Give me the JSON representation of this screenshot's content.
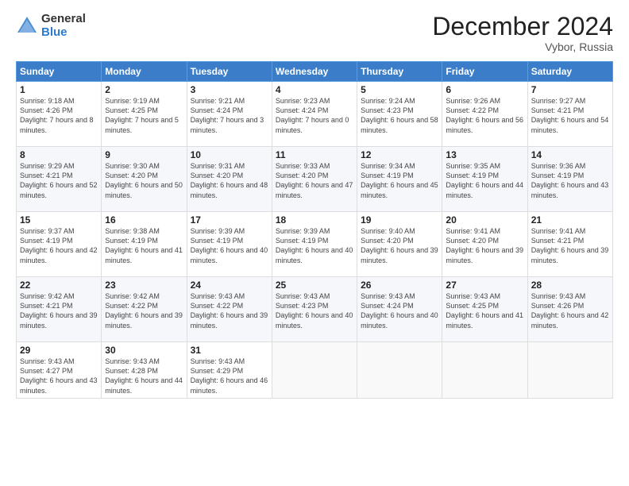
{
  "header": {
    "logo_general": "General",
    "logo_blue": "Blue",
    "month_title": "December 2024",
    "location": "Vybor, Russia"
  },
  "weekdays": [
    "Sunday",
    "Monday",
    "Tuesday",
    "Wednesday",
    "Thursday",
    "Friday",
    "Saturday"
  ],
  "weeks": [
    [
      {
        "day": "1",
        "sunrise": "9:18 AM",
        "sunset": "4:26 PM",
        "daylight": "7 hours and 8 minutes."
      },
      {
        "day": "2",
        "sunrise": "9:19 AM",
        "sunset": "4:25 PM",
        "daylight": "7 hours and 5 minutes."
      },
      {
        "day": "3",
        "sunrise": "9:21 AM",
        "sunset": "4:24 PM",
        "daylight": "7 hours and 3 minutes."
      },
      {
        "day": "4",
        "sunrise": "9:23 AM",
        "sunset": "4:24 PM",
        "daylight": "7 hours and 0 minutes."
      },
      {
        "day": "5",
        "sunrise": "9:24 AM",
        "sunset": "4:23 PM",
        "daylight": "6 hours and 58 minutes."
      },
      {
        "day": "6",
        "sunrise": "9:26 AM",
        "sunset": "4:22 PM",
        "daylight": "6 hours and 56 minutes."
      },
      {
        "day": "7",
        "sunrise": "9:27 AM",
        "sunset": "4:21 PM",
        "daylight": "6 hours and 54 minutes."
      }
    ],
    [
      {
        "day": "8",
        "sunrise": "9:29 AM",
        "sunset": "4:21 PM",
        "daylight": "6 hours and 52 minutes."
      },
      {
        "day": "9",
        "sunrise": "9:30 AM",
        "sunset": "4:20 PM",
        "daylight": "6 hours and 50 minutes."
      },
      {
        "day": "10",
        "sunrise": "9:31 AM",
        "sunset": "4:20 PM",
        "daylight": "6 hours and 48 minutes."
      },
      {
        "day": "11",
        "sunrise": "9:33 AM",
        "sunset": "4:20 PM",
        "daylight": "6 hours and 47 minutes."
      },
      {
        "day": "12",
        "sunrise": "9:34 AM",
        "sunset": "4:19 PM",
        "daylight": "6 hours and 45 minutes."
      },
      {
        "day": "13",
        "sunrise": "9:35 AM",
        "sunset": "4:19 PM",
        "daylight": "6 hours and 44 minutes."
      },
      {
        "day": "14",
        "sunrise": "9:36 AM",
        "sunset": "4:19 PM",
        "daylight": "6 hours and 43 minutes."
      }
    ],
    [
      {
        "day": "15",
        "sunrise": "9:37 AM",
        "sunset": "4:19 PM",
        "daylight": "6 hours and 42 minutes."
      },
      {
        "day": "16",
        "sunrise": "9:38 AM",
        "sunset": "4:19 PM",
        "daylight": "6 hours and 41 minutes."
      },
      {
        "day": "17",
        "sunrise": "9:39 AM",
        "sunset": "4:19 PM",
        "daylight": "6 hours and 40 minutes."
      },
      {
        "day": "18",
        "sunrise": "9:39 AM",
        "sunset": "4:19 PM",
        "daylight": "6 hours and 40 minutes."
      },
      {
        "day": "19",
        "sunrise": "9:40 AM",
        "sunset": "4:20 PM",
        "daylight": "6 hours and 39 minutes."
      },
      {
        "day": "20",
        "sunrise": "9:41 AM",
        "sunset": "4:20 PM",
        "daylight": "6 hours and 39 minutes."
      },
      {
        "day": "21",
        "sunrise": "9:41 AM",
        "sunset": "4:21 PM",
        "daylight": "6 hours and 39 minutes."
      }
    ],
    [
      {
        "day": "22",
        "sunrise": "9:42 AM",
        "sunset": "4:21 PM",
        "daylight": "6 hours and 39 minutes."
      },
      {
        "day": "23",
        "sunrise": "9:42 AM",
        "sunset": "4:22 PM",
        "daylight": "6 hours and 39 minutes."
      },
      {
        "day": "24",
        "sunrise": "9:43 AM",
        "sunset": "4:22 PM",
        "daylight": "6 hours and 39 minutes."
      },
      {
        "day": "25",
        "sunrise": "9:43 AM",
        "sunset": "4:23 PM",
        "daylight": "6 hours and 40 minutes."
      },
      {
        "day": "26",
        "sunrise": "9:43 AM",
        "sunset": "4:24 PM",
        "daylight": "6 hours and 40 minutes."
      },
      {
        "day": "27",
        "sunrise": "9:43 AM",
        "sunset": "4:25 PM",
        "daylight": "6 hours and 41 minutes."
      },
      {
        "day": "28",
        "sunrise": "9:43 AM",
        "sunset": "4:26 PM",
        "daylight": "6 hours and 42 minutes."
      }
    ],
    [
      {
        "day": "29",
        "sunrise": "9:43 AM",
        "sunset": "4:27 PM",
        "daylight": "6 hours and 43 minutes."
      },
      {
        "day": "30",
        "sunrise": "9:43 AM",
        "sunset": "4:28 PM",
        "daylight": "6 hours and 44 minutes."
      },
      {
        "day": "31",
        "sunrise": "9:43 AM",
        "sunset": "4:29 PM",
        "daylight": "6 hours and 46 minutes."
      },
      null,
      null,
      null,
      null
    ]
  ]
}
